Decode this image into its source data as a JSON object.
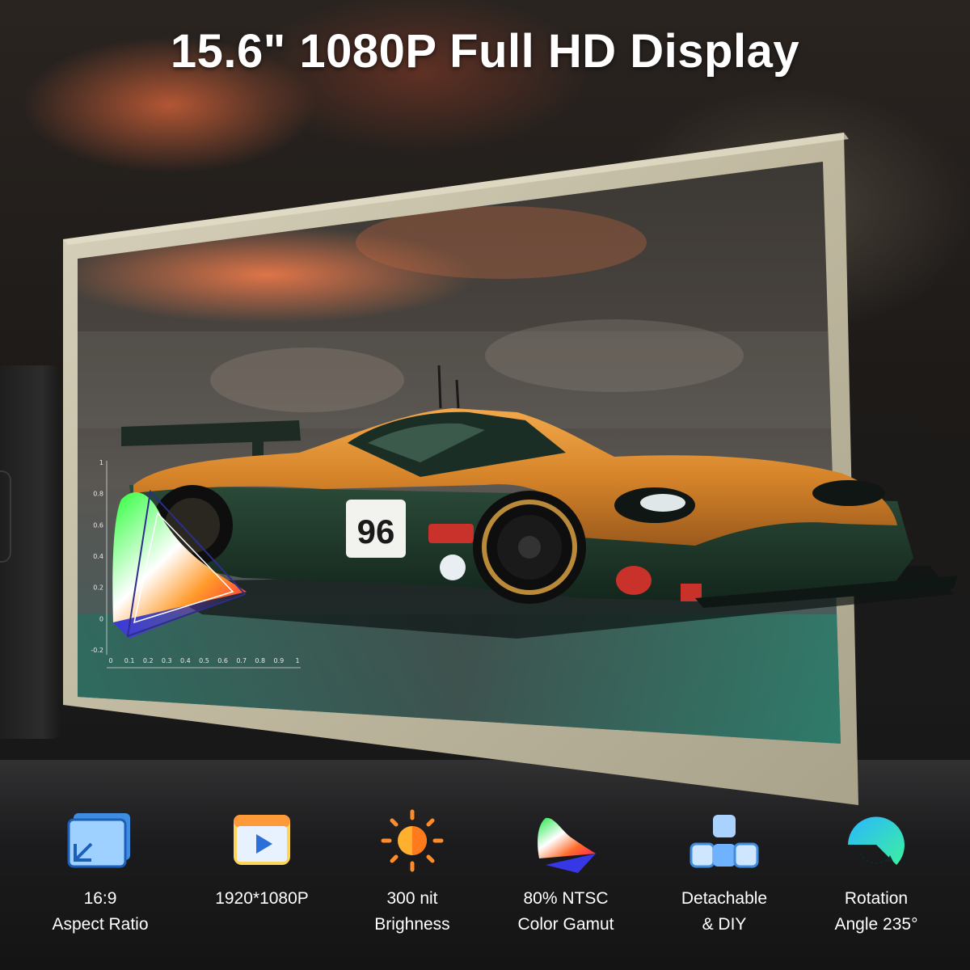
{
  "title": "15.6\" 1080P Full HD Display",
  "screen": {
    "car_number": "96",
    "chart": {
      "y_ticks": [
        "1",
        "0.8",
        "0.6",
        "0.4",
        "0.2",
        "0",
        "-0.2"
      ],
      "x_ticks": [
        "0",
        "0.1",
        "0.2",
        "0.3",
        "0.4",
        "0.5",
        "0.6",
        "0.7",
        "0.8",
        "0.9",
        "1"
      ]
    }
  },
  "features": [
    {
      "icon": "aspect-ratio-icon",
      "line1": "16:9",
      "line2": "Aspect Ratio"
    },
    {
      "icon": "video-player-icon",
      "line1": "1920*1080P",
      "line2": ""
    },
    {
      "icon": "brightness-icon",
      "line1": "300 nit",
      "line2": "Brighness"
    },
    {
      "icon": "color-gamut-icon",
      "line1": "80% NTSC",
      "line2": "Color Gamut"
    },
    {
      "icon": "modular-blocks-icon",
      "line1": "Detachable",
      "line2": "& DIY"
    },
    {
      "icon": "rotation-icon",
      "line1": "Rotation",
      "line2": "Angle 235°"
    }
  ],
  "colors": {
    "bezel": "#c9c3ad",
    "car_orange": "#d98a2b",
    "car_green": "#1f3a2c",
    "text": "#ffffff"
  }
}
